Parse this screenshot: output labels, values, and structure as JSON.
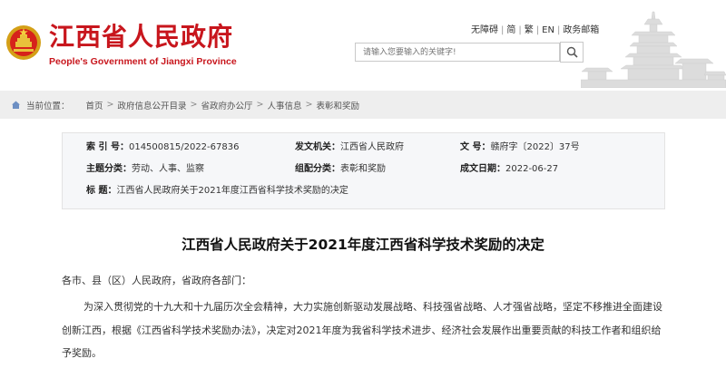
{
  "header": {
    "site_title": "江西省人民政府",
    "site_subtitle": "People's Government of Jiangxi Province",
    "links": [
      "无障碍",
      "简",
      "繁",
      "EN",
      "政务邮箱"
    ],
    "search_placeholder": "请输入您要输入的关键字!",
    "emblem_icon": "national-emblem-icon",
    "search_icon": "magnifier-icon",
    "brand_color": "#c8161d"
  },
  "breadcrumb": {
    "prefix": "当前位置：",
    "items": [
      "首页",
      "政府信息公开目录",
      "省政府办公厅",
      "人事信息",
      "表彰和奖励"
    ]
  },
  "info": {
    "index_label": "索  引  号：",
    "index_value": "014500815/2022-67836",
    "issuer_label": "发文机关：",
    "issuer_value": "江西省人民政府",
    "docno_label": "文      号：",
    "docno_value": "赣府字〔2022〕37号",
    "subject_label": "主题分类：",
    "subject_value": "劳动、人事、监察",
    "category_label": "组配分类：",
    "category_value": "表彰和奖励",
    "date_label": "成文日期：",
    "date_value": "2022-06-27",
    "title_label": "标      题：",
    "title_value": "江西省人民政府关于2021年度江西省科学技术奖励的决定"
  },
  "article": {
    "title": "江西省人民政府关于2021年度江西省科学技术奖励的决定",
    "salutation": "各市、县（区）人民政府，省政府各部门：",
    "body": "为深入贯彻党的十九大和十九届历次全会精神，大力实施创新驱动发展战略、科技强省战略、人才强省战略，坚定不移推进全面建设创新江西，根据《江西省科学技术奖励办法》，决定对2021年度为我省科学技术进步、经济社会发展作出重要贡献的科技工作者和组织给予奖励。"
  }
}
